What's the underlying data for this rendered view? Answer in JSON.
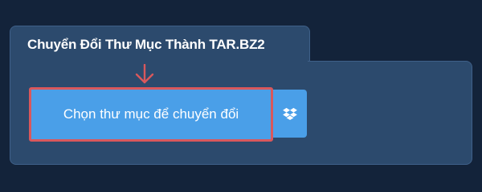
{
  "converter": {
    "title": "Chuyển Đổi Thư Mục Thành TAR.BZ2",
    "choose_button_label": "Chọn thư mục để chuyển đổi"
  },
  "icons": {
    "arrow": "arrow-down-icon",
    "dropbox": "dropbox-icon"
  },
  "colors": {
    "background": "#13233a",
    "panel": "#2c4a6d",
    "button": "#4a9fe8",
    "highlight": "#d9585c"
  }
}
